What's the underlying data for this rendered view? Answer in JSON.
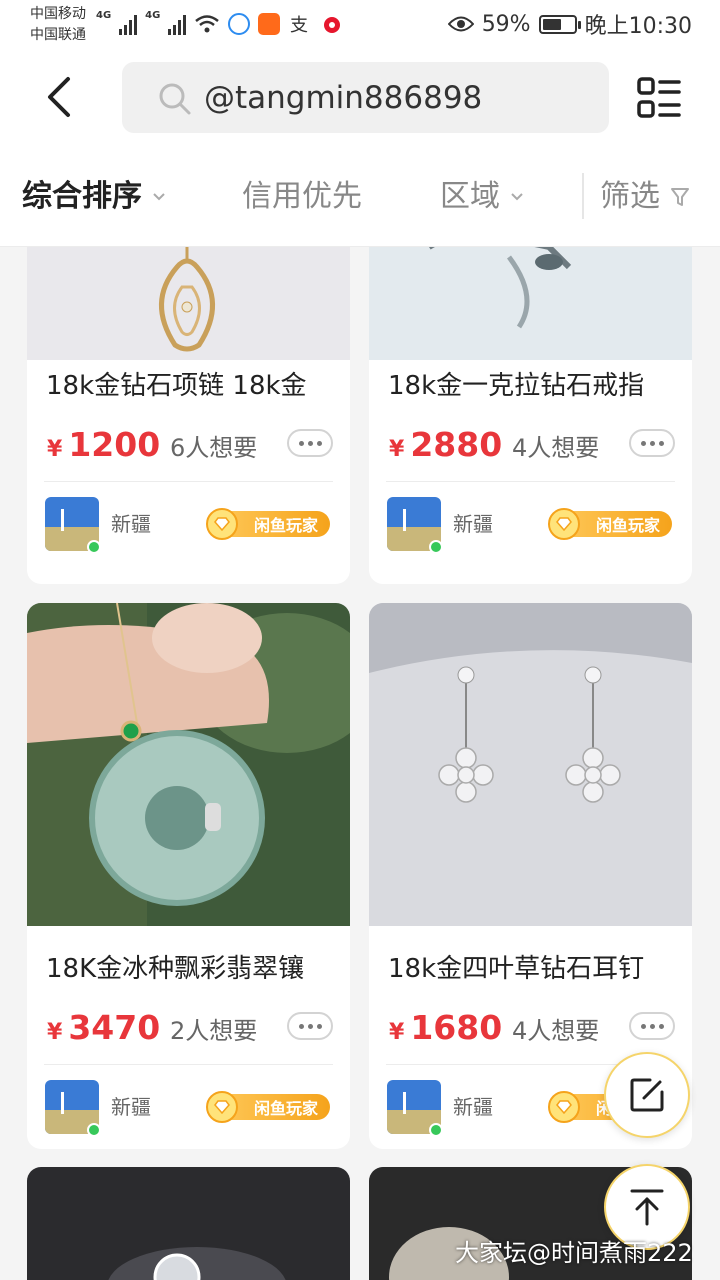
{
  "status_bar": {
    "carrier_1": "中国移动",
    "carrier_2": "中国联通",
    "network_1": "4G",
    "network_2": "4G",
    "battery_percent": "59%",
    "battery_level": 0.59,
    "time": "晚上10:30"
  },
  "header": {
    "search_value": "@tangmin886898"
  },
  "filters": {
    "sort": "综合排序",
    "credit": "信用优先",
    "region": "区域",
    "filter": "筛选"
  },
  "listings": [
    {
      "title": "18k金钻石项链 18k金",
      "currency": "¥",
      "price": "1200",
      "wants": "6人想要",
      "location": "新疆",
      "badge": "闲鱼玩家"
    },
    {
      "title": "18k金一克拉钻石戒指",
      "currency": "¥",
      "price": "2880",
      "wants": "4人想要",
      "location": "新疆",
      "badge": "闲鱼玩家"
    },
    {
      "title": "18K金冰种飘彩翡翠镶",
      "currency": "¥",
      "price": "3470",
      "wants": "2人想要",
      "location": "新疆",
      "badge": "闲鱼玩家"
    },
    {
      "title": "18k金四叶草钻石耳钉",
      "currency": "¥",
      "price": "1680",
      "wants": "4人想要",
      "location": "新疆",
      "badge": "闲鱼玩家"
    }
  ],
  "watermark": "大家坛@时间煮雨222",
  "colors": {
    "price": "#e8363b",
    "badge": "#f5a31b",
    "accent_ring": "#f5d46a"
  }
}
